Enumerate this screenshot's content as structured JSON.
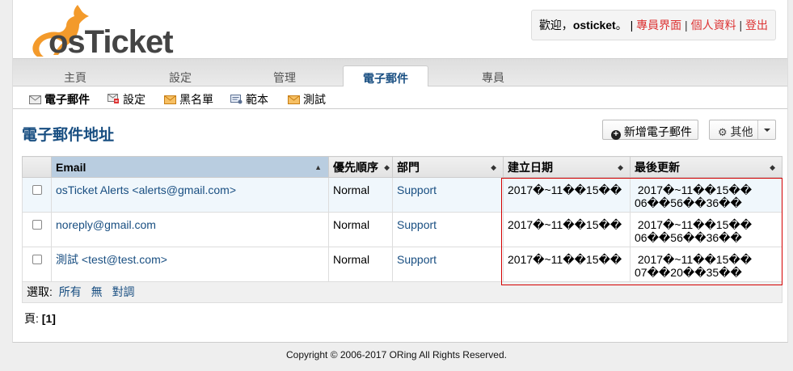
{
  "header": {
    "logo_text": "osTicket",
    "welcome_prefix": "歡迎，",
    "username": "osticket",
    "welcome_suffix": "。 |",
    "links": [
      "專員界面",
      "個人資料",
      "登出"
    ],
    "separator": "|"
  },
  "nav": {
    "tabs": [
      {
        "label": "主頁"
      },
      {
        "label": "設定"
      },
      {
        "label": "管理"
      },
      {
        "label": "電子郵件",
        "active": true
      },
      {
        "label": "專員"
      }
    ]
  },
  "subnav": {
    "items": [
      {
        "label": "電子郵件",
        "icon": "envelope-icon",
        "active": true
      },
      {
        "label": "設定",
        "icon": "envelope-settings-icon"
      },
      {
        "label": "黑名單",
        "icon": "banned-envelope-icon"
      },
      {
        "label": "範本",
        "icon": "template-icon"
      },
      {
        "label": "測試",
        "icon": "test-email-icon"
      }
    ]
  },
  "page": {
    "title": "電子郵件地址",
    "add_button": "新增電子郵件",
    "add_icon": "plus-circle-icon",
    "more_button": "其他",
    "more_icon": "gear-icon"
  },
  "table": {
    "headers": [
      "Email",
      "優先順序",
      "部門",
      "建立日期",
      "最後更新"
    ],
    "rows": [
      {
        "email": "osTicket Alerts <alerts@gmail.com>",
        "priority": "Normal",
        "department": "Support",
        "created": "2017�~11��15��",
        "updated_1": " 2017�~11��15��",
        "updated_2": "06��56��36��"
      },
      {
        "email": "noreply@gmail.com",
        "priority": "Normal",
        "department": "Support",
        "created": "2017�~11��15��",
        "updated_1": " 2017�~11��15��",
        "updated_2": "06��56��36��"
      },
      {
        "email": "測試 <test@test.com>",
        "priority": "Normal",
        "department": "Support",
        "created": "2017�~11��15��",
        "updated_1": " 2017�~11��15��",
        "updated_2": "07��20��35��"
      }
    ],
    "select_label": "選取:",
    "select_all": "所有",
    "select_none": "無",
    "select_toggle": "對調"
  },
  "pager": {
    "label": "頁:",
    "current": "[1]"
  },
  "footer": {
    "copyright": "Copyright © 2006-2017 ORing All Rights Reserved."
  },
  "colors": {
    "link": "#184e81",
    "header_link": "#dd3333",
    "highlight_box": "#d40000"
  }
}
